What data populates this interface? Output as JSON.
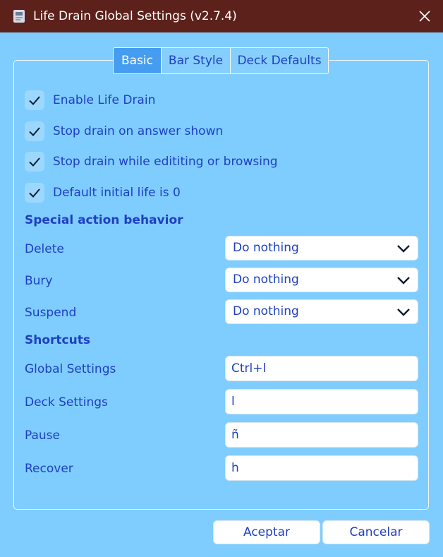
{
  "window": {
    "title": "Life Drain Global Settings (v2.7.4)",
    "icon": "app-icon",
    "close_icon": "close-icon"
  },
  "tabs": [
    {
      "label": "Basic",
      "active": true
    },
    {
      "label": "Bar Style",
      "active": false
    },
    {
      "label": "Deck Defaults",
      "active": false
    }
  ],
  "options": [
    {
      "label": "Enable Life Drain",
      "checked": true
    },
    {
      "label": "Stop drain on answer shown",
      "checked": true
    },
    {
      "label": "Stop drain while edititing or browsing",
      "checked": true
    },
    {
      "label": "Default initial life is 0",
      "checked": true
    }
  ],
  "special_actions": {
    "heading": "Special action behavior",
    "rows": [
      {
        "label": "Delete",
        "value": "Do nothing"
      },
      {
        "label": "Bury",
        "value": "Do nothing"
      },
      {
        "label": "Suspend",
        "value": "Do nothing"
      }
    ]
  },
  "shortcuts": {
    "heading": "Shortcuts",
    "rows": [
      {
        "label": "Global Settings",
        "value": "Ctrl+l"
      },
      {
        "label": "Deck Settings",
        "value": "l"
      },
      {
        "label": "Pause",
        "value": "ñ"
      },
      {
        "label": "Recover",
        "value": "h"
      }
    ]
  },
  "buttons": {
    "accept": "Aceptar",
    "cancel": "Cancelar"
  },
  "colors": {
    "background": "#7fcdfe",
    "titlebar": "#5c211b",
    "text": "#1f3fc3",
    "tab_active": "#469df0"
  }
}
